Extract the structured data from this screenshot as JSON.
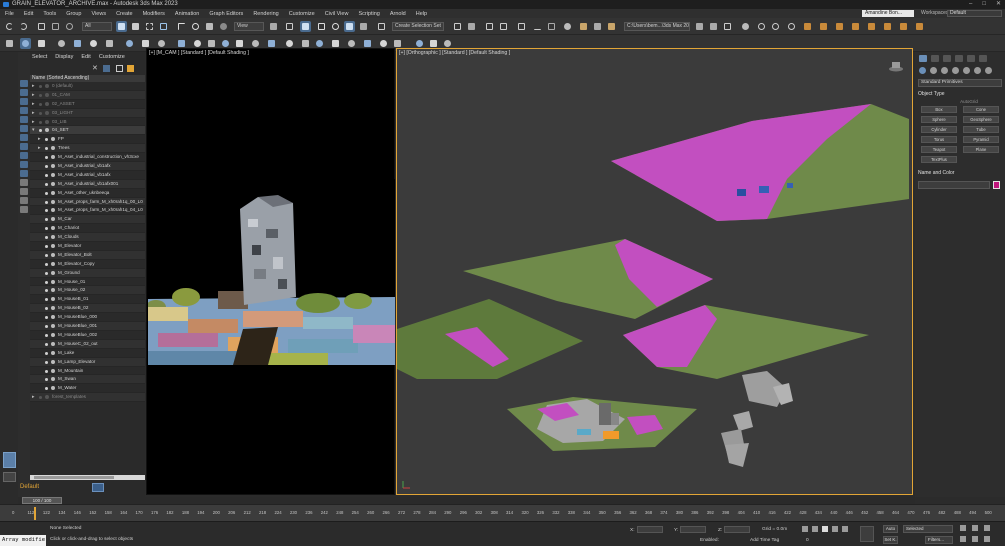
{
  "window": {
    "title": "GRAIN_ELEVATOR_ARCHIVE.max - Autodesk 3ds Max 2023"
  },
  "menu": {
    "items": [
      "File",
      "Edit",
      "Tools",
      "Group",
      "Views",
      "Create",
      "Modifiers",
      "Animation",
      "Graph Editors",
      "Rendering",
      "Customize",
      "Civil View",
      "Scripting",
      "Arnold",
      "Help"
    ],
    "user": "Amandine Bon...",
    "workspace_label": "Workspaces:",
    "workspace_value": "Default"
  },
  "toolbar1": {
    "filter_dropdown": "All",
    "ref_coord_dropdown": "View",
    "selection_set": "Create Selection Set",
    "project_path": "C:\\Users\\bem...\\3ds Max 202"
  },
  "explorer": {
    "tabs": [
      "Select",
      "Display",
      "Edit",
      "Customize"
    ],
    "header": "Name (Sorted Ascending)",
    "rows": [
      {
        "label": "0 (default)",
        "level": 0,
        "type": "layer",
        "dim": true
      },
      {
        "label": "01_CAM",
        "level": 0,
        "type": "layer",
        "dim": true
      },
      {
        "label": "02_ASSET",
        "level": 0,
        "type": "layer",
        "dim": true
      },
      {
        "label": "03_LIGHT",
        "level": 0,
        "type": "layer",
        "dim": true
      },
      {
        "label": "03_LIB",
        "level": 0,
        "type": "layer",
        "dim": true
      },
      {
        "label": "04_SET",
        "level": 0,
        "type": "layer-open",
        "dim": false
      },
      {
        "label": "FP",
        "level": 1,
        "type": "layer",
        "dim": false
      },
      {
        "label": "Trees",
        "level": 1,
        "type": "layer",
        "dim": false
      },
      {
        "label": "M_Aset_industrial_construction_vh3cxe",
        "level": 1,
        "type": "obj",
        "dim": false
      },
      {
        "label": "M_Aset_industrial_vb1afx",
        "level": 1,
        "type": "obj",
        "dim": false
      },
      {
        "label": "M_Aset_industrial_vb1afx",
        "level": 1,
        "type": "obj",
        "dim": false
      },
      {
        "label": "M_Aset_industrial_vb1afx001",
        "level": 1,
        "type": "obj",
        "dim": false
      },
      {
        "label": "M_Aset_other_uknbeeqa",
        "level": 1,
        "type": "obj",
        "dim": false
      },
      {
        "label": "M_Aset_props_farm_M_xh0rah1q_00_L0",
        "level": 1,
        "type": "obj",
        "dim": false
      },
      {
        "label": "M_Aset_props_farm_M_xh0rah1q_04_L0",
        "level": 1,
        "type": "obj",
        "dim": false
      },
      {
        "label": "M_Car",
        "level": 1,
        "type": "obj",
        "dim": false
      },
      {
        "label": "M_Chariot",
        "level": 1,
        "type": "obj",
        "dim": false
      },
      {
        "label": "M_Clouds",
        "level": 1,
        "type": "obj",
        "dim": false
      },
      {
        "label": "M_Elevator",
        "level": 1,
        "type": "obj",
        "dim": false
      },
      {
        "label": "M_Elevator_Bolt",
        "level": 1,
        "type": "obj",
        "dim": false
      },
      {
        "label": "M_Elevator_Copy",
        "level": 1,
        "type": "obj",
        "dim": false
      },
      {
        "label": "M_Ground",
        "level": 1,
        "type": "obj",
        "dim": false
      },
      {
        "label": "M_House_01",
        "level": 1,
        "type": "obj",
        "dim": false
      },
      {
        "label": "M_House_02",
        "level": 1,
        "type": "obj",
        "dim": false
      },
      {
        "label": "M_HouseB_01",
        "level": 1,
        "type": "obj",
        "dim": false
      },
      {
        "label": "M_HouseB_02",
        "level": 1,
        "type": "obj",
        "dim": false
      },
      {
        "label": "M_HouseBlue_000",
        "level": 1,
        "type": "obj",
        "dim": false
      },
      {
        "label": "M_HouseBlue_001",
        "level": 1,
        "type": "obj",
        "dim": false
      },
      {
        "label": "M_HouseBlue_002",
        "level": 1,
        "type": "obj",
        "dim": false
      },
      {
        "label": "M_HouseC_02_out",
        "level": 1,
        "type": "obj",
        "dim": false
      },
      {
        "label": "M_Lake",
        "level": 1,
        "type": "obj",
        "dim": false
      },
      {
        "label": "M_Lamp_Elevator",
        "level": 1,
        "type": "obj",
        "dim": false
      },
      {
        "label": "M_Mountain",
        "level": 1,
        "type": "obj",
        "dim": false
      },
      {
        "label": "M_Swan",
        "level": 1,
        "type": "obj",
        "dim": false
      },
      {
        "label": "M_Water",
        "level": 1,
        "type": "obj",
        "dim": false
      },
      {
        "label": "forest_templates",
        "level": 0,
        "type": "layer",
        "dim": true
      }
    ],
    "active_layer": "Default"
  },
  "viewports": {
    "left_label": "[+] [M_CAM ] [Standard ] [Default Shading ]",
    "right_label": "[+] [Orthographic ] [Standard ] [Default Shading ]"
  },
  "command_panel": {
    "category_dropdown": "Standard Primitives",
    "object_type_title": "Object Type",
    "autogrid": "AutoGrid",
    "buttons": [
      "Box",
      "Cone",
      "Sphere",
      "GeoSphere",
      "Cylinder",
      "Tube",
      "Torus",
      "Pyramid",
      "Teapot",
      "Plane",
      "TextPlus"
    ],
    "name_color_title": "Name and Color",
    "swatch_color": "#c0167c"
  },
  "timeline": {
    "slider_label": "100 / 100",
    "ticks": [
      "0",
      "112",
      "122",
      "134",
      "146",
      "152",
      "158",
      "164",
      "170",
      "176",
      "182",
      "188",
      "194",
      "200",
      "206",
      "212",
      "218",
      "224",
      "230",
      "236",
      "242",
      "248",
      "254",
      "260",
      "266",
      "272",
      "278",
      "284",
      "290",
      "296",
      "302",
      "308",
      "314",
      "320",
      "326",
      "332",
      "338",
      "344",
      "350",
      "356",
      "362",
      "368",
      "374",
      "380",
      "386",
      "392",
      "398",
      "404",
      "410",
      "416",
      "422",
      "428",
      "434",
      "440",
      "446",
      "452",
      "458",
      "464",
      "470",
      "476",
      "482",
      "488",
      "494",
      "500"
    ]
  },
  "status": {
    "maxscript": "Array modifie",
    "selection": "None Selected",
    "prompt": "Click or click-and-drag to select objects",
    "x_label": "X:",
    "y_label": "Y:",
    "z_label": "Z:",
    "grid": "Grid = 0.0m",
    "add_time_tag": "Add Time Tag",
    "enabled": "Enabled:",
    "auto": "Auto",
    "set_k": "Set K.",
    "selected_dropdown": "Selected",
    "filters": "Filters...",
    "frame": "0"
  }
}
